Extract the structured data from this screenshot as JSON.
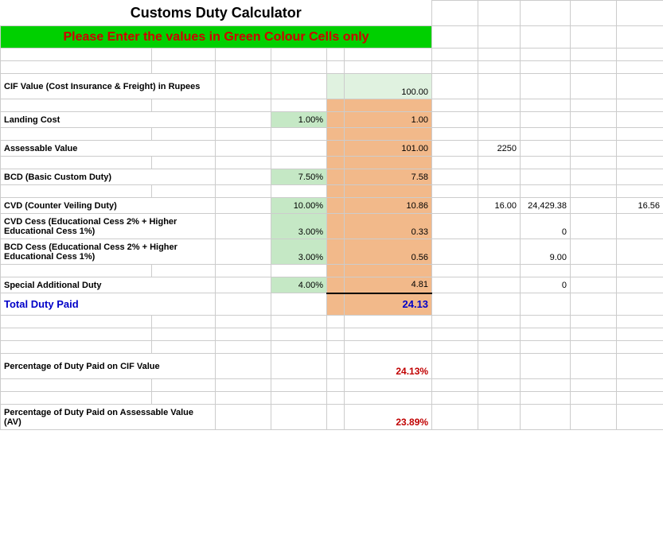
{
  "title": "Customs Duty Calculator",
  "instruction": "Please Enter the values in Green Colour Cells only",
  "rows": {
    "cif": {
      "label": "CIF Value (Cost Insurance & Freight) in Rupees",
      "value": "100.00"
    },
    "landing": {
      "label": "Landing Cost",
      "pct": "1.00%",
      "value": "1.00"
    },
    "assessable": {
      "label": "Assessable Value",
      "value": "101.00",
      "extra_h": "2250"
    },
    "bcd": {
      "label": "BCD (Basic Custom Duty)",
      "pct": "7.50%",
      "value": "7.58"
    },
    "cvd": {
      "label": "CVD (Counter Veiling Duty)",
      "pct": "10.00%",
      "value": "10.86",
      "extra_h": "16.00",
      "extra_i": "24,429.38",
      "extra_k": "16.56"
    },
    "cvdcess": {
      "label": "CVD Cess (Educational Cess 2% + Higher Educational Cess 1%)",
      "pct": "3.00%",
      "value": "0.33",
      "extra_i": "0"
    },
    "bcdcess": {
      "label": "BCD Cess (Educational Cess 2% + Higher Educational Cess 1%)",
      "pct": "3.00%",
      "value": "0.56",
      "extra_i": "9.00"
    },
    "sad": {
      "label": "Special Additional Duty",
      "pct": "4.00%",
      "value": "4.81",
      "extra_i": "0"
    },
    "total": {
      "label": "Total Duty Paid",
      "value": "24.13"
    },
    "pct_cif": {
      "label": "Percentage of Duty Paid on CIF Value",
      "value": "24.13%"
    },
    "pct_av": {
      "label": "Percentage of Duty Paid on Assessable Value (AV)",
      "value": "23.89%"
    }
  }
}
